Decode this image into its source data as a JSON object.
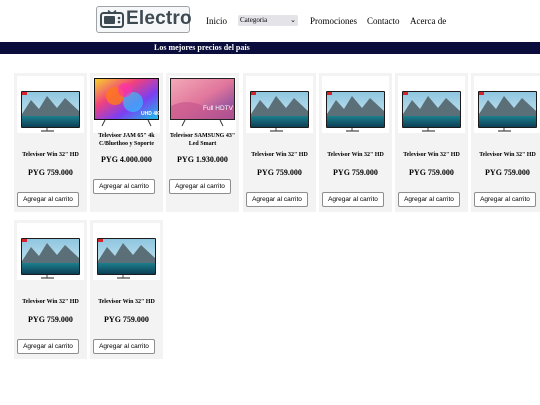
{
  "header": {
    "logo_text": "Electro",
    "nav": {
      "inicio": "Inicio",
      "categoria": "Categoria",
      "promociones": "Promociones",
      "contacto": "Contacto",
      "acerca": "Acerca de"
    }
  },
  "banner": {
    "text": "Los mejores precios del país"
  },
  "products": [
    {
      "title": "Televisor Win 32\" HD",
      "price": "PYG 759.000",
      "button": "Agregar al carrito",
      "image": "tv-lake-icon"
    },
    {
      "title": "Televisor JAM 65\" 4k C/Bluethoo y Soporte",
      "price": "PYG 4.000.000",
      "button": "Agregar al carrito",
      "image": "tv-colorful-4k-icon",
      "image_label": "UHD 4K"
    },
    {
      "title": "Televisor SAMSUNG 43\" Led Smart",
      "price": "PYG 1.930.000",
      "button": "Agregar al carrito",
      "image": "tv-sunset-icon",
      "image_label": "Full HDTV"
    },
    {
      "title": "Televisor Win 32\" HD",
      "price": "PYG 759.000",
      "button": "Agregar al carrito",
      "image": "tv-lake-icon"
    },
    {
      "title": "Televisor Win 32\" HD",
      "price": "PYG 759.000",
      "button": "Agregar al carrito",
      "image": "tv-lake-icon"
    },
    {
      "title": "Televisor Win 32\" HD",
      "price": "PYG 759.000",
      "button": "Agregar al carrito",
      "image": "tv-lake-icon"
    },
    {
      "title": "Televisor Win 32\" HD",
      "price": "PYG 759.000",
      "button": "Agregar al carrito",
      "image": "tv-lake-icon"
    },
    {
      "title": "Televisor Win 32\" HD",
      "price": "PYG 759.000",
      "button": "Agregar al carrito",
      "image": "tv-lake-icon"
    },
    {
      "title": "Televisor Win 32\" HD",
      "price": "PYG 759.000",
      "button": "Agregar al carrito",
      "image": "tv-lake-icon"
    }
  ],
  "colors": {
    "banner": "#0a0c3b",
    "card_bg": "#f3f3f3",
    "logo_text": "#3e4a52"
  }
}
